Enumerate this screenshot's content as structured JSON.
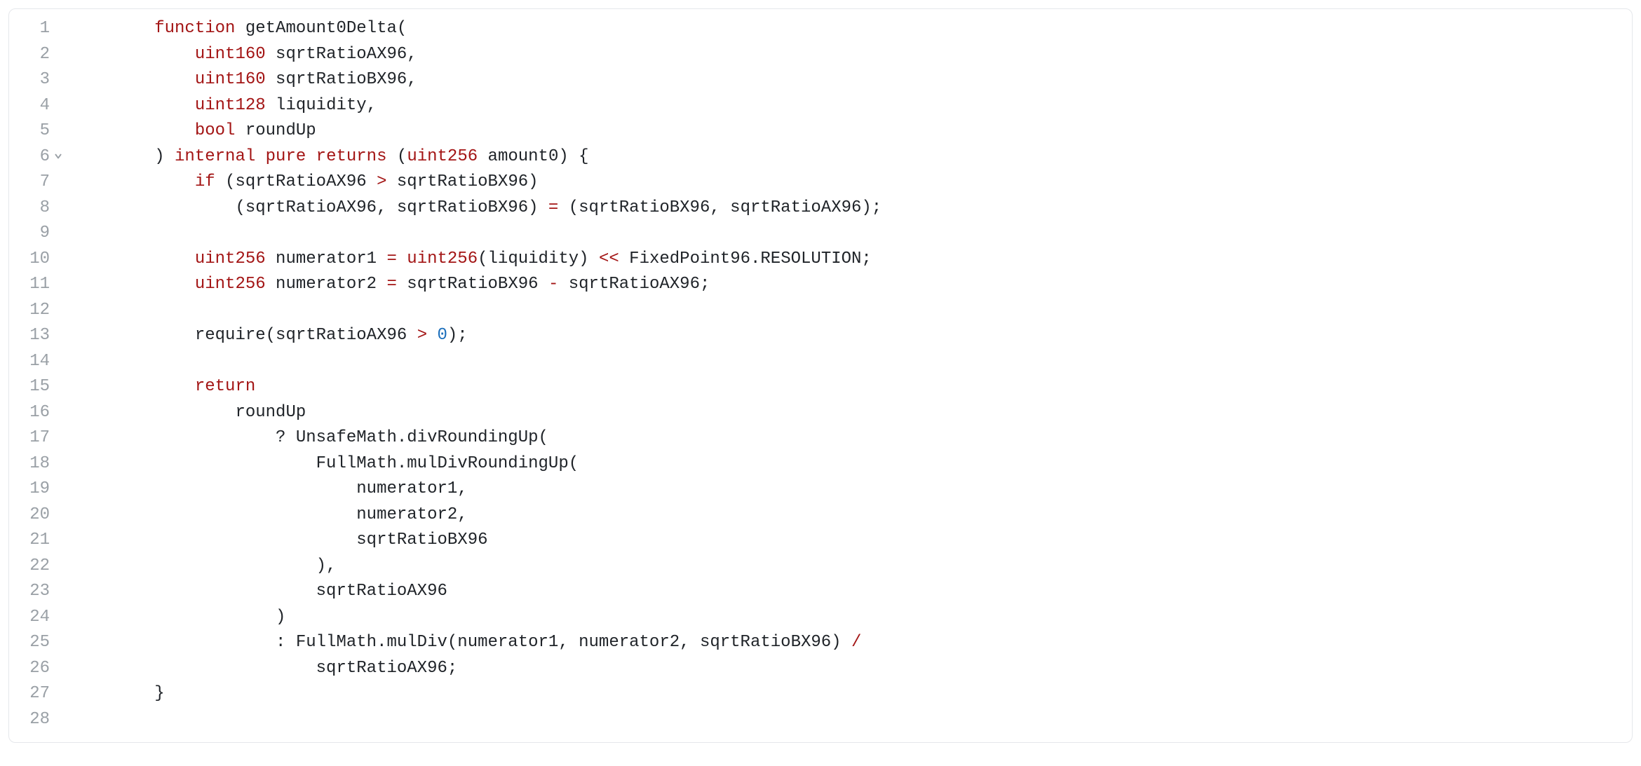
{
  "colors": {
    "keyword": "#a31515",
    "number": "#1c6fbc",
    "default": "#1f2328",
    "gutter": "#9aa0a6",
    "border": "#e5e7eb"
  },
  "lines": [
    {
      "n": 1,
      "fold": false,
      "tokens": [
        {
          "t": "        ",
          "c": "default"
        },
        {
          "t": "function",
          "c": "kw"
        },
        {
          "t": " getAmount0Delta(",
          "c": "default"
        }
      ]
    },
    {
      "n": 2,
      "fold": false,
      "tokens": [
        {
          "t": "            ",
          "c": "default"
        },
        {
          "t": "uint160",
          "c": "kw"
        },
        {
          "t": " sqrtRatioAX96,",
          "c": "default"
        }
      ]
    },
    {
      "n": 3,
      "fold": false,
      "tokens": [
        {
          "t": "            ",
          "c": "default"
        },
        {
          "t": "uint160",
          "c": "kw"
        },
        {
          "t": " sqrtRatioBX96,",
          "c": "default"
        }
      ]
    },
    {
      "n": 4,
      "fold": false,
      "tokens": [
        {
          "t": "            ",
          "c": "default"
        },
        {
          "t": "uint128",
          "c": "kw"
        },
        {
          "t": " liquidity,",
          "c": "default"
        }
      ]
    },
    {
      "n": 5,
      "fold": false,
      "tokens": [
        {
          "t": "            ",
          "c": "default"
        },
        {
          "t": "bool",
          "c": "kw"
        },
        {
          "t": " roundUp",
          "c": "default"
        }
      ]
    },
    {
      "n": 6,
      "fold": true,
      "tokens": [
        {
          "t": "        ) ",
          "c": "default"
        },
        {
          "t": "internal",
          "c": "kw"
        },
        {
          "t": " ",
          "c": "default"
        },
        {
          "t": "pure",
          "c": "kw"
        },
        {
          "t": " ",
          "c": "default"
        },
        {
          "t": "returns",
          "c": "kw"
        },
        {
          "t": " (",
          "c": "default"
        },
        {
          "t": "uint256",
          "c": "kw"
        },
        {
          "t": " amount0) {",
          "c": "default"
        }
      ]
    },
    {
      "n": 7,
      "fold": false,
      "tokens": [
        {
          "t": "            ",
          "c": "default"
        },
        {
          "t": "if",
          "c": "kw"
        },
        {
          "t": " (sqrtRatioAX96 ",
          "c": "default"
        },
        {
          "t": ">",
          "c": "op"
        },
        {
          "t": " sqrtRatioBX96)",
          "c": "default"
        }
      ]
    },
    {
      "n": 8,
      "fold": false,
      "tokens": [
        {
          "t": "                (sqrtRatioAX96, sqrtRatioBX96) ",
          "c": "default"
        },
        {
          "t": "=",
          "c": "op"
        },
        {
          "t": " (sqrtRatioBX96, sqrtRatioAX96);",
          "c": "default"
        }
      ]
    },
    {
      "n": 9,
      "fold": false,
      "tokens": [
        {
          "t": "",
          "c": "default"
        }
      ]
    },
    {
      "n": 10,
      "fold": false,
      "tokens": [
        {
          "t": "            ",
          "c": "default"
        },
        {
          "t": "uint256",
          "c": "kw"
        },
        {
          "t": " numerator1 ",
          "c": "default"
        },
        {
          "t": "=",
          "c": "op"
        },
        {
          "t": " ",
          "c": "default"
        },
        {
          "t": "uint256",
          "c": "kw"
        },
        {
          "t": "(liquidity) ",
          "c": "default"
        },
        {
          "t": "<<",
          "c": "op"
        },
        {
          "t": " FixedPoint96.RESOLUTION;",
          "c": "default"
        }
      ]
    },
    {
      "n": 11,
      "fold": false,
      "tokens": [
        {
          "t": "            ",
          "c": "default"
        },
        {
          "t": "uint256",
          "c": "kw"
        },
        {
          "t": " numerator2 ",
          "c": "default"
        },
        {
          "t": "=",
          "c": "op"
        },
        {
          "t": " sqrtRatioBX96 ",
          "c": "default"
        },
        {
          "t": "-",
          "c": "op"
        },
        {
          "t": " sqrtRatioAX96;",
          "c": "default"
        }
      ]
    },
    {
      "n": 12,
      "fold": false,
      "tokens": [
        {
          "t": "",
          "c": "default"
        }
      ]
    },
    {
      "n": 13,
      "fold": false,
      "tokens": [
        {
          "t": "            require(sqrtRatioAX96 ",
          "c": "default"
        },
        {
          "t": ">",
          "c": "op"
        },
        {
          "t": " ",
          "c": "default"
        },
        {
          "t": "0",
          "c": "num"
        },
        {
          "t": ");",
          "c": "default"
        }
      ]
    },
    {
      "n": 14,
      "fold": false,
      "tokens": [
        {
          "t": "",
          "c": "default"
        }
      ]
    },
    {
      "n": 15,
      "fold": false,
      "tokens": [
        {
          "t": "            ",
          "c": "default"
        },
        {
          "t": "return",
          "c": "kw"
        }
      ]
    },
    {
      "n": 16,
      "fold": false,
      "tokens": [
        {
          "t": "                roundUp",
          "c": "default"
        }
      ]
    },
    {
      "n": 17,
      "fold": false,
      "tokens": [
        {
          "t": "                    ? UnsafeMath.divRoundingUp(",
          "c": "default"
        }
      ]
    },
    {
      "n": 18,
      "fold": false,
      "tokens": [
        {
          "t": "                        FullMath.mulDivRoundingUp(",
          "c": "default"
        }
      ]
    },
    {
      "n": 19,
      "fold": false,
      "tokens": [
        {
          "t": "                            numerator1,",
          "c": "default"
        }
      ]
    },
    {
      "n": 20,
      "fold": false,
      "tokens": [
        {
          "t": "                            numerator2,",
          "c": "default"
        }
      ]
    },
    {
      "n": 21,
      "fold": false,
      "tokens": [
        {
          "t": "                            sqrtRatioBX96",
          "c": "default"
        }
      ]
    },
    {
      "n": 22,
      "fold": false,
      "tokens": [
        {
          "t": "                        ),",
          "c": "default"
        }
      ]
    },
    {
      "n": 23,
      "fold": false,
      "tokens": [
        {
          "t": "                        sqrtRatioAX96",
          "c": "default"
        }
      ]
    },
    {
      "n": 24,
      "fold": false,
      "tokens": [
        {
          "t": "                    )",
          "c": "default"
        }
      ]
    },
    {
      "n": 25,
      "fold": false,
      "tokens": [
        {
          "t": "                    : FullMath.mulDiv(numerator1, numerator2, sqrtRatioBX96) ",
          "c": "default"
        },
        {
          "t": "/",
          "c": "op"
        }
      ]
    },
    {
      "n": 26,
      "fold": false,
      "tokens": [
        {
          "t": "                        sqrtRatioAX96;",
          "c": "default"
        }
      ]
    },
    {
      "n": 27,
      "fold": false,
      "tokens": [
        {
          "t": "        }",
          "c": "default"
        }
      ]
    },
    {
      "n": 28,
      "fold": false,
      "tokens": [
        {
          "t": "",
          "c": "default"
        }
      ]
    }
  ]
}
